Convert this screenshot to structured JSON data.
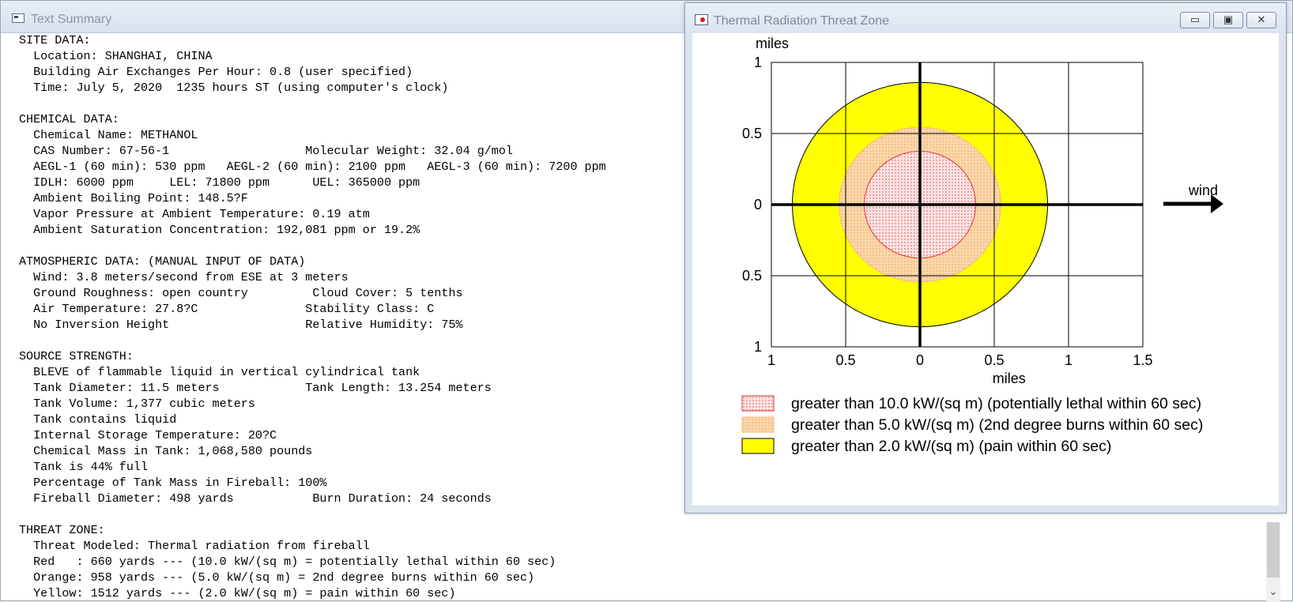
{
  "text_summary": {
    "title": "Text Summary",
    "lines": [
      "SITE DATA:",
      "  Location: SHANGHAI, CHINA",
      "  Building Air Exchanges Per Hour: 0.8 (user specified)",
      "  Time: July 5, 2020  1235 hours ST (using computer's clock)",
      "",
      "CHEMICAL DATA:",
      "  Chemical Name: METHANOL",
      "  CAS Number: 67-56-1                   Molecular Weight: 32.04 g/mol",
      "  AEGL-1 (60 min): 530 ppm   AEGL-2 (60 min): 2100 ppm   AEGL-3 (60 min): 7200 ppm",
      "  IDLH: 6000 ppm     LEL: 71800 ppm      UEL: 365000 ppm",
      "  Ambient Boiling Point: 148.5?F",
      "  Vapor Pressure at Ambient Temperature: 0.19 atm",
      "  Ambient Saturation Concentration: 192,081 ppm or 19.2%",
      "",
      "ATMOSPHERIC DATA: (MANUAL INPUT OF DATA)",
      "  Wind: 3.8 meters/second from ESE at 3 meters",
      "  Ground Roughness: open country         Cloud Cover: 5 tenths",
      "  Air Temperature: 27.8?C               Stability Class: C",
      "  No Inversion Height                   Relative Humidity: 75%",
      "",
      "SOURCE STRENGTH:",
      "  BLEVE of flammable liquid in vertical cylindrical tank",
      "  Tank Diameter: 11.5 meters            Tank Length: 13.254 meters",
      "  Tank Volume: 1,377 cubic meters",
      "  Tank contains liquid",
      "  Internal Storage Temperature: 20?C",
      "  Chemical Mass in Tank: 1,068,580 pounds",
      "  Tank is 44% full",
      "  Percentage of Tank Mass in Fireball: 100%",
      "  Fireball Diameter: 498 yards           Burn Duration: 24 seconds",
      "",
      "THREAT ZONE:",
      "  Threat Modeled: Thermal radiation from fireball",
      "  Red   : 660 yards --- (10.0 kW/(sq m) = potentially lethal within 60 sec)",
      "  Orange: 958 yards --- (5.0 kW/(sq m) = 2nd degree burns within 60 sec)",
      "  Yellow: 1512 yards --- (2.0 kW/(sq m) = pain within 60 sec)"
    ],
    "scroll_down_glyph": "⌄"
  },
  "threat_window": {
    "title": "Thermal Radiation Threat Zone",
    "buttons": {
      "minimize": "▭",
      "restore": "▣",
      "close": "✕"
    },
    "wind_label": "wind",
    "legend": [
      {
        "label": "greater than 10.0 kW/(sq m) (potentially lethal within 60 sec)",
        "color": "#fbe3e3",
        "dot_color": "#e23a3a",
        "border": "#e23a3a"
      },
      {
        "label": "greater than 5.0 kW/(sq m) (2nd degree burns within 60 sec)",
        "color": "#fad7aa",
        "dot_color": "#f5b880",
        "border": "#f5b880"
      },
      {
        "label": "greater than 2.0 kW/(sq m) (pain within 60 sec)",
        "color": "#ffff00",
        "border": "#000000"
      }
    ]
  },
  "chart_data": {
    "type": "threat-zone",
    "xlabel": "miles",
    "ylabel": "miles",
    "x_ticks": [
      "1",
      "0.5",
      "0",
      "0.5",
      "1",
      "1.5"
    ],
    "y_ticks": [
      "1",
      "0.5",
      "0",
      "0.5",
      "1"
    ],
    "xlim": [
      -1,
      1.5
    ],
    "ylim": [
      -1,
      1
    ],
    "grid": true,
    "zones": [
      {
        "name": "Yellow",
        "radius_miles": 0.859,
        "color": "#ffff00"
      },
      {
        "name": "Orange",
        "radius_miles": 0.544,
        "color": "#fad7aa"
      },
      {
        "name": "Red",
        "radius_miles": 0.375,
        "color": "#fbe3e3"
      }
    ]
  }
}
